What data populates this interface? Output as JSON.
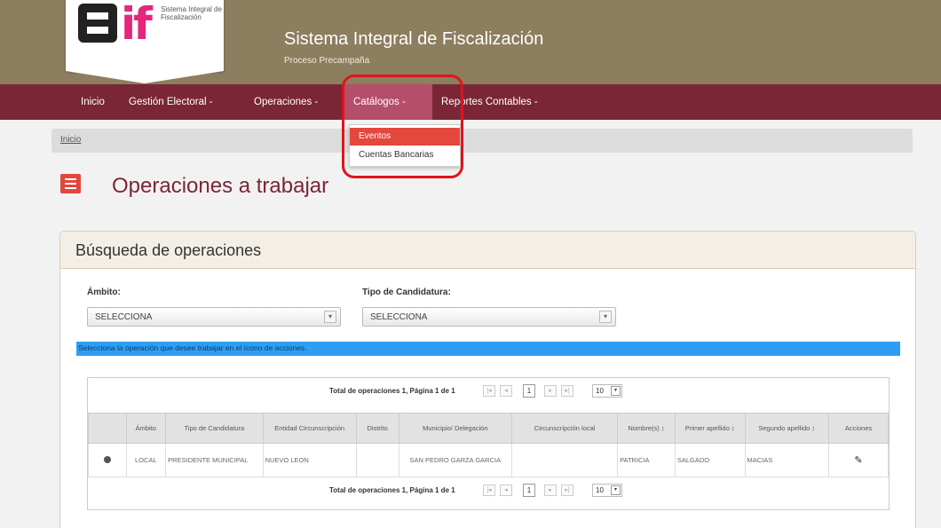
{
  "header": {
    "logo_text": "Sistema Integral de Fiscalización",
    "logo_mark": "if",
    "title": "Sistema Integral de Fiscalización",
    "subtitle": "Proceso Precampaña"
  },
  "nav": {
    "items": [
      {
        "label": "Inicio"
      },
      {
        "label": "Gestión Electoral -"
      },
      {
        "label": "Operaciones -"
      },
      {
        "label": "Catálogos -"
      },
      {
        "label": "Reportes Contables -"
      }
    ],
    "dropdown": [
      {
        "label": "Eventos"
      },
      {
        "label": "Cuentas Bancarias"
      }
    ]
  },
  "breadcrumb": {
    "home": "Inicio"
  },
  "page": {
    "title": "Operaciones a trabajar"
  },
  "search": {
    "title": "Búsqueda de operaciones",
    "ambito_label": "Ámbito:",
    "ambito_value": "SELECCIONA",
    "tipo_label": "Tipo de Candidatura:",
    "tipo_value": "SELECCIONA",
    "info": "Selecciona la operación que desee trabajar en el ícono de acciones."
  },
  "pager": {
    "summary": "Total de operaciones 1, Página 1 de 1",
    "current_page": "1",
    "page_size": "10"
  },
  "table": {
    "headers": [
      "",
      "Ámbito",
      "Tipo de Candidatura",
      "Entidad Circunscripción",
      "Distrito",
      "Municipio/ Delegación",
      "Circunscripción local",
      "Nombre(s) ↕",
      "Primer apellido ↕",
      "Segundo apellido ↕",
      "Acciones"
    ],
    "rows": [
      [
        "",
        "LOCAL",
        "PRESIDENTE MUNICIPAL",
        "NUEVO LEON",
        "",
        "SAN PEDRO GARZA GARCIA",
        "",
        "PATRICIA",
        "SALGADO",
        "MACIAS",
        ""
      ]
    ]
  },
  "colors": {
    "header_bg": "#8c7e5e",
    "nav_bg": "#7a2637",
    "accent": "#e4473c",
    "info_bar": "#2e9ef2",
    "highlight_box": "#e0141b"
  },
  "icons": [
    "menu-icon",
    "radio-select-icon",
    "edit-pencil-icon",
    "select-arrow-icon"
  ]
}
